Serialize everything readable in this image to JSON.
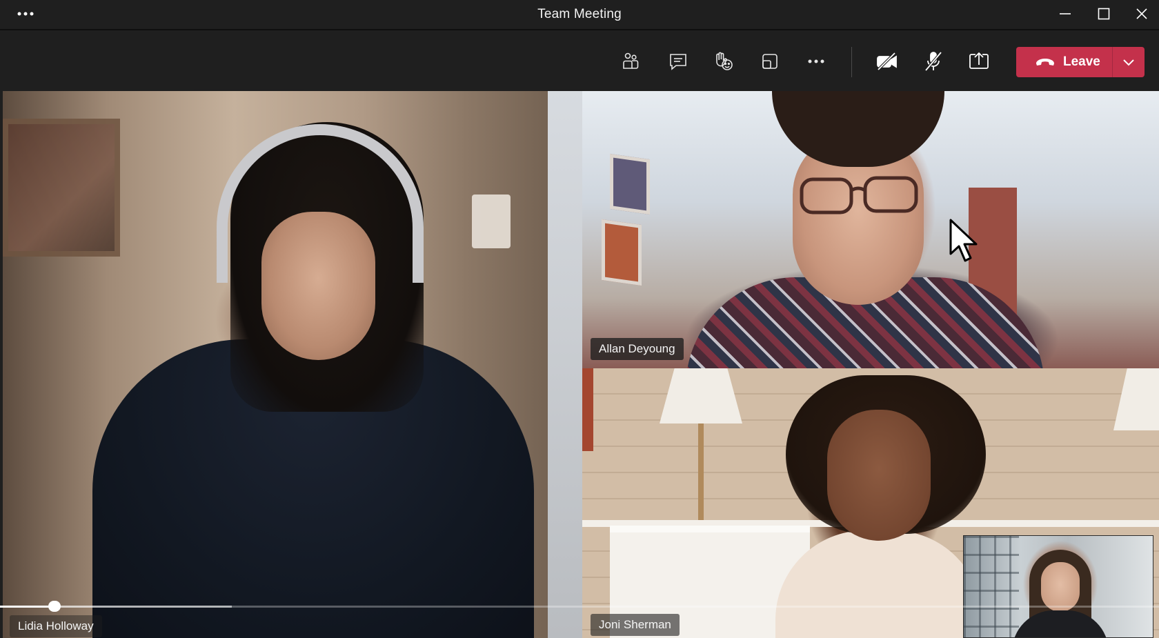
{
  "window": {
    "title": "Team Meeting"
  },
  "icons": {
    "title_more": "more-horizontal-icon",
    "minimize": "minimize-icon",
    "maximize": "maximize-icon",
    "close": "close-icon",
    "people": "people-icon",
    "chat": "chat-icon",
    "react": "raise-hand-react-icon",
    "view": "view-layout-icon",
    "more": "more-actions-icon",
    "camera": "camera-off-icon",
    "mic": "mic-off-icon",
    "share": "share-screen-icon",
    "leave": "phone-hangup-icon",
    "leave_menu": "chevron-down-icon"
  },
  "toolbar": {
    "leave_label": "Leave"
  },
  "participants": [
    {
      "name": "Lidia Holloway"
    },
    {
      "name": "Allan Deyoung"
    },
    {
      "name": "Joni Sherman"
    }
  ],
  "playback": {
    "progress": 0.047,
    "buffered": 0.2
  },
  "colors": {
    "leave_button": "#c4314b",
    "toolbar_bg": "#1f1f1f"
  }
}
